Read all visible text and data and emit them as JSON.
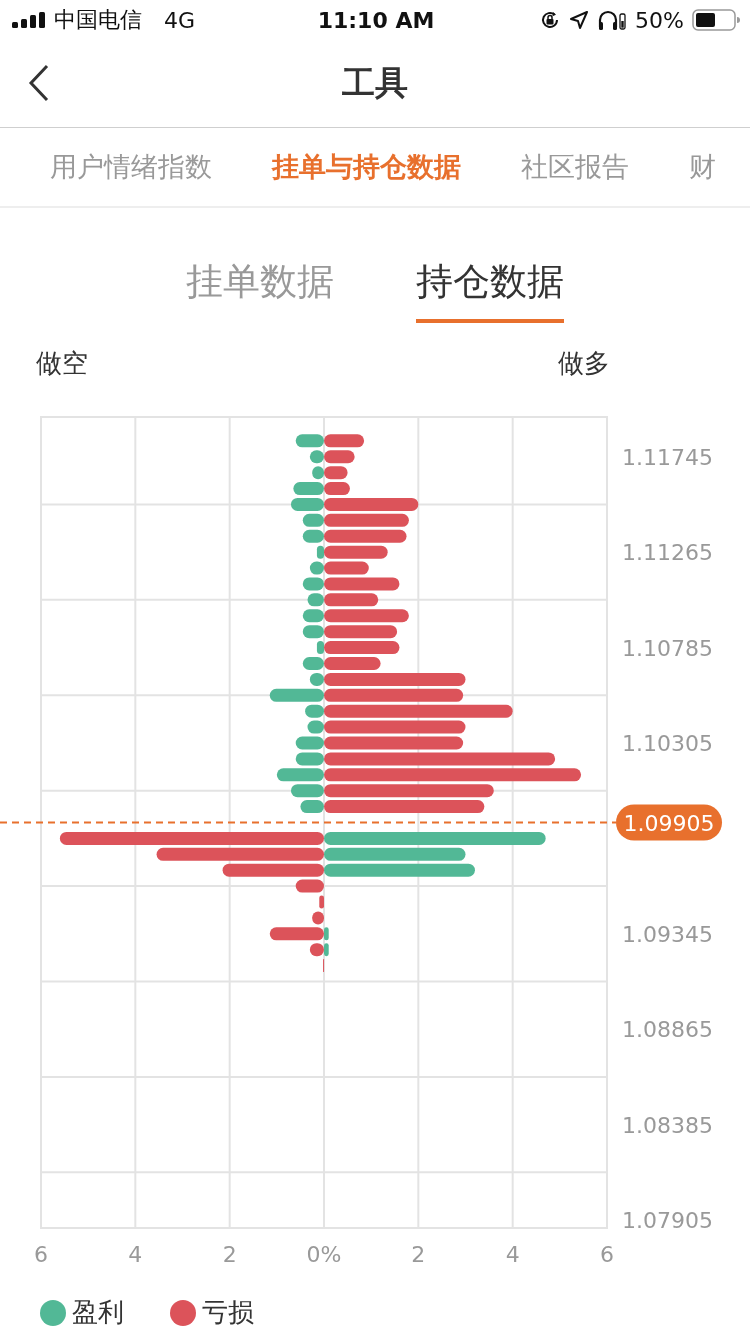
{
  "status_bar": {
    "carrier": "中国电信",
    "network": "4G",
    "time": "11:10 AM",
    "battery_percent": "50%"
  },
  "nav": {
    "title": "工具"
  },
  "tabs": [
    {
      "label": "用户情绪指数",
      "selected": false
    },
    {
      "label": "挂单与持仓数据",
      "selected": true
    },
    {
      "label": "社区报告",
      "selected": false
    },
    {
      "label": "财",
      "selected": false
    }
  ],
  "subtabs": [
    {
      "label": "挂单数据",
      "selected": false
    },
    {
      "label": "持仓数据",
      "selected": true
    }
  ],
  "side_labels": {
    "left": "做空",
    "right": "做多"
  },
  "chart": {
    "chart_data": {
      "type": "bar",
      "orientation": "horizontal",
      "stacked": true,
      "grid": true,
      "x": [
        1.11825,
        1.11745,
        1.11665,
        1.11585,
        1.11505,
        1.11425,
        1.11345,
        1.11265,
        1.11185,
        1.11105,
        1.11025,
        1.10945,
        1.10865,
        1.10785,
        1.10705,
        1.10625,
        1.10545,
        1.10465,
        1.10385,
        1.10305,
        1.10225,
        1.10145,
        1.10065,
        1.09985,
        1.09825,
        1.09745,
        1.09665,
        1.09585,
        1.09505,
        1.09425,
        1.09345,
        1.09265,
        1.09185
      ],
      "series": [
        {
          "name": "盈利",
          "color": "#52b896",
          "values": [
            -0.6,
            -0.3,
            -0.25,
            -0.65,
            -0.7,
            -0.45,
            -0.45,
            -0.15,
            -0.3,
            -0.45,
            -0.35,
            -0.45,
            -0.45,
            -0.15,
            -0.45,
            -0.3,
            -1.15,
            -0.4,
            -0.35,
            -0.6,
            -0.6,
            -1.0,
            -0.7,
            -0.5,
            4.7,
            3.0,
            3.2,
            null,
            null,
            null,
            0.1,
            0.1,
            null
          ]
        },
        {
          "name": "亏损",
          "color": "#dc535a",
          "values": [
            0.85,
            0.65,
            0.5,
            0.55,
            2.0,
            1.8,
            1.75,
            1.35,
            0.95,
            1.6,
            1.15,
            1.8,
            1.55,
            1.6,
            1.2,
            3.0,
            2.95,
            4.0,
            3.0,
            2.95,
            4.9,
            5.45,
            3.6,
            3.4,
            -5.6,
            -3.55,
            -2.15,
            -0.6,
            -0.1,
            -0.25,
            -1.15,
            -0.3,
            -0.02
          ]
        }
      ],
      "xlim": [
        -6,
        6
      ],
      "ylim": [
        1.07865,
        1.11945
      ],
      "xticks": [
        {
          "value": -6,
          "label": "6"
        },
        {
          "value": -4,
          "label": "4"
        },
        {
          "value": -2,
          "label": "2"
        },
        {
          "value": 0,
          "label": "0%"
        },
        {
          "value": 2,
          "label": "2"
        },
        {
          "value": 4,
          "label": "4"
        },
        {
          "value": 6,
          "label": "6"
        }
      ],
      "yticks": [
        {
          "value": 1.11745,
          "label": "1.11745"
        },
        {
          "value": 1.11265,
          "label": "1.11265"
        },
        {
          "value": 1.10785,
          "label": "1.10785"
        },
        {
          "value": 1.10305,
          "label": "1.10305"
        },
        {
          "value": 1.09345,
          "label": "1.09345"
        },
        {
          "value": 1.08865,
          "label": "1.08865"
        },
        {
          "value": 1.08385,
          "label": "1.08385"
        },
        {
          "value": 1.07905,
          "label": "1.07905"
        }
      ],
      "ref_lines": [
        {
          "axis": "y",
          "value": 1.09905,
          "label": "1.09905"
        }
      ]
    }
  }
}
